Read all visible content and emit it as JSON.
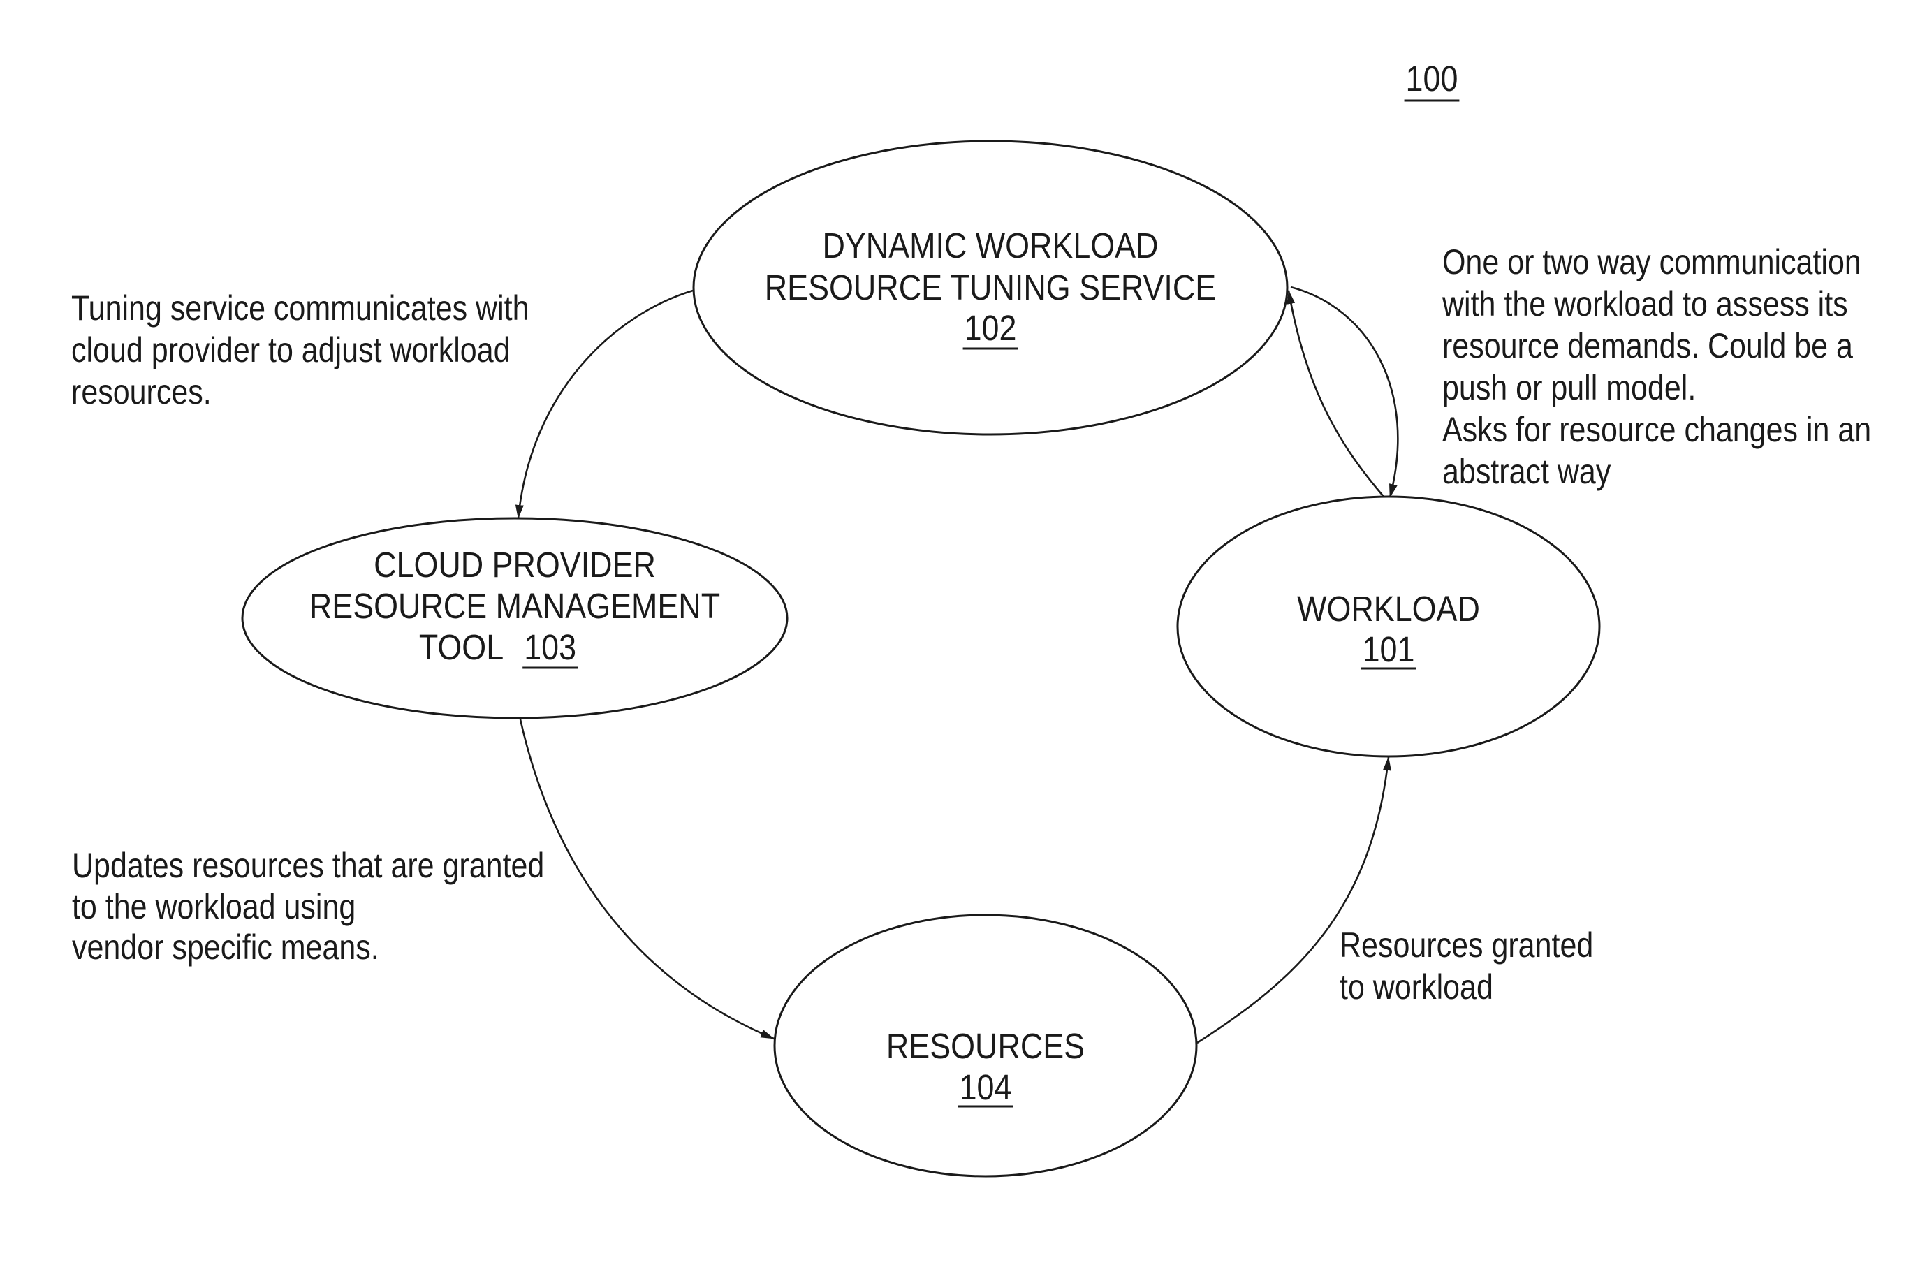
{
  "figure": {
    "ref_label": "100",
    "colors": {
      "ink": "#1a1a1a",
      "background": "#ffffff"
    }
  },
  "nodes": {
    "tuning_service": {
      "lines": [
        "DYNAMIC WORKLOAD",
        "RESOURCE TUNING SERVICE"
      ],
      "ref": "102"
    },
    "cloud_tool": {
      "lines": [
        "CLOUD PROVIDER",
        "RESOURCE MANAGEMENT",
        "TOOL"
      ],
      "ref": "103"
    },
    "workload": {
      "lines": [
        "WORKLOAD"
      ],
      "ref": "101"
    },
    "resources": {
      "lines": [
        "RESOURCES"
      ],
      "ref": "104"
    }
  },
  "edges": [
    {
      "from": "DYNAMIC WORKLOAD RESOURCE TUNING SERVICE 102",
      "to": "CLOUD PROVIDER RESOURCE MANAGEMENT TOOL 103"
    },
    {
      "from": "CLOUD PROVIDER RESOURCE MANAGEMENT TOOL 103",
      "to": "RESOURCES 104"
    },
    {
      "from": "RESOURCES 104",
      "to": "WORKLOAD 101"
    },
    {
      "from": "WORKLOAD 101",
      "to": "DYNAMIC WORKLOAD RESOURCE TUNING SERVICE 102"
    },
    {
      "from": "DYNAMIC WORKLOAD RESOURCE TUNING SERVICE 102",
      "to": "WORKLOAD 101"
    }
  ],
  "annotations": {
    "tuning_to_cloud": [
      "Tuning service communicates with",
      "cloud provider to adjust workload",
      "resources."
    ],
    "workload_communication": [
      "One or two way communication",
      "with the workload to assess its",
      "resource demands. Could be a",
      "push or pull model.",
      "Asks for resource changes in an",
      "abstract way"
    ],
    "cloud_to_resources": [
      "Updates resources that are granted",
      "to the workload using",
      "vendor specific means."
    ],
    "resources_to_workload": [
      "Resources granted",
      "to workload"
    ]
  }
}
